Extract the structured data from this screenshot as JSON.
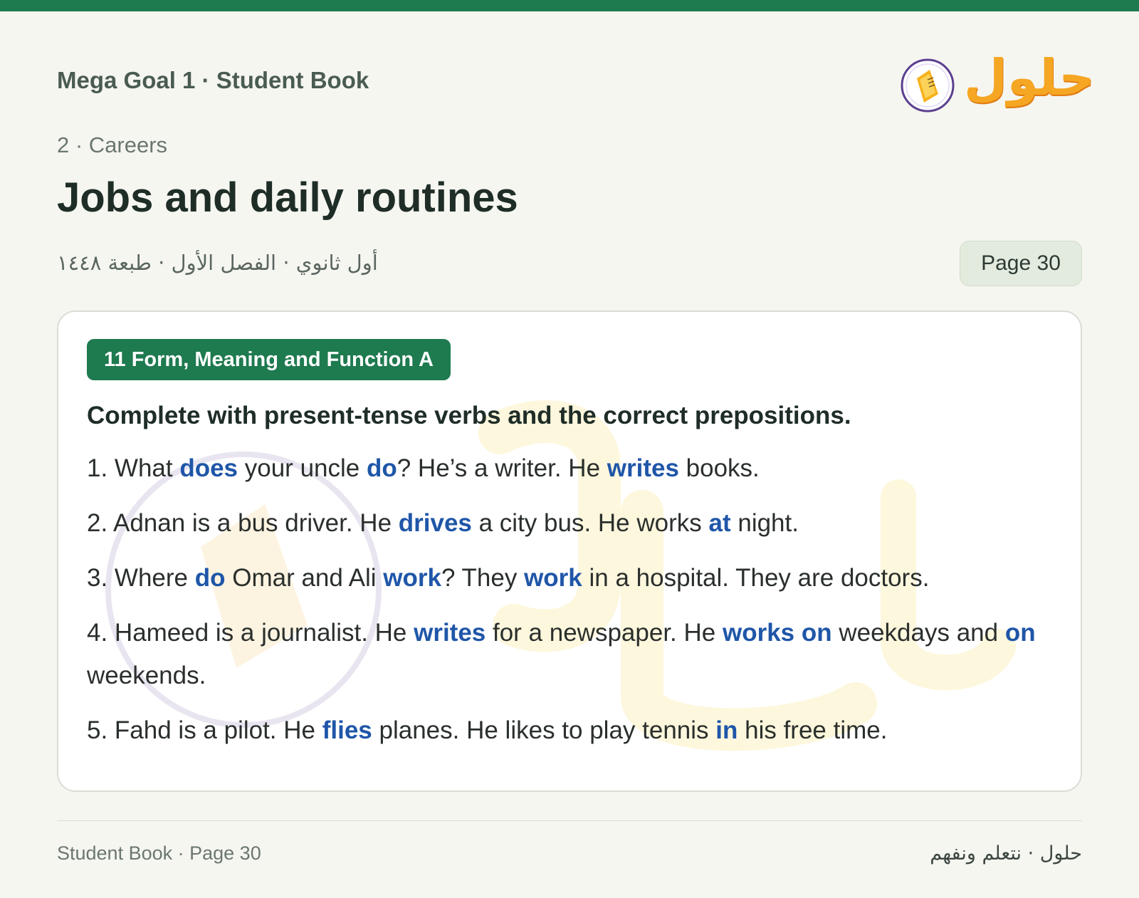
{
  "header": {
    "book_title": "Mega Goal 1 · Student Book",
    "chapter": "2 · Careers",
    "lesson_title": "Jobs and daily routines",
    "arabic_subtitle": "أول ثانوي · الفصل الأول · طبعة ١٤٤٨",
    "page_label": "Page 30",
    "logo_text": "حلول"
  },
  "exercise": {
    "badge": "11 Form, Meaning and Function A",
    "instruction": "Complete with present-tense verbs and the correct prepositions.",
    "items": [
      [
        {
          "t": "1. What "
        },
        {
          "t": "does",
          "a": true
        },
        {
          "t": " your uncle "
        },
        {
          "t": "do",
          "a": true
        },
        {
          "t": "? He’s a writer. He "
        },
        {
          "t": "writes",
          "a": true
        },
        {
          "t": " books."
        }
      ],
      [
        {
          "t": "2. Adnan is a bus driver. He "
        },
        {
          "t": "drives",
          "a": true
        },
        {
          "t": " a city bus. He works "
        },
        {
          "t": "at",
          "a": true
        },
        {
          "t": " night."
        }
      ],
      [
        {
          "t": "3. Where "
        },
        {
          "t": "do",
          "a": true
        },
        {
          "t": " Omar and Ali "
        },
        {
          "t": "work",
          "a": true
        },
        {
          "t": "? They "
        },
        {
          "t": "work",
          "a": true
        },
        {
          "t": " in a hospital. They are doctors."
        }
      ],
      [
        {
          "t": "4. Hameed is a journalist. He "
        },
        {
          "t": "writes",
          "a": true
        },
        {
          "t": " for a newspaper. He "
        },
        {
          "t": "works on",
          "a": true
        },
        {
          "t": " weekdays and "
        },
        {
          "t": "on",
          "a": true
        },
        {
          "t": " weekends."
        }
      ],
      [
        {
          "t": "5. Fahd is a pilot. He "
        },
        {
          "t": "flies",
          "a": true
        },
        {
          "t": " planes. He likes to play tennis "
        },
        {
          "t": "in",
          "a": true
        },
        {
          "t": " his free time."
        }
      ]
    ]
  },
  "footer": {
    "left": "Student Book · Page 30",
    "right": "حلول · نتعلم ونفهم"
  },
  "colors": {
    "accent_green": "#1e7a4f",
    "answer_blue": "#1f56a8",
    "logo_orange": "#f5a623"
  },
  "icons": {
    "logo": "hulul-book-logo-icon",
    "watermark": "hulul-watermark-icon"
  }
}
